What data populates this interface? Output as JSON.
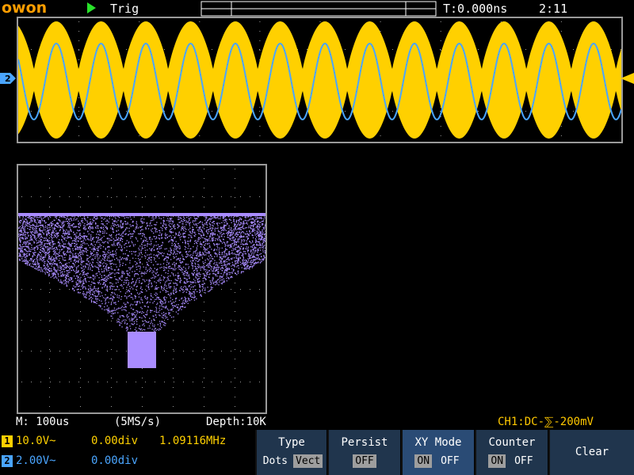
{
  "header": {
    "brand": "owon",
    "trigger_label": "Trig",
    "trigger_time": "T:0.000ns",
    "clock": "2:11"
  },
  "markers": {
    "ch2_marker": "2"
  },
  "status": {
    "timebase": "M: 100us",
    "sample_rate": "(5MS/s)",
    "depth": "Depth:10K",
    "trigger_info": "CH1:DC-⅀-200mV"
  },
  "channels": [
    {
      "id": "1",
      "scale": "10.0V~",
      "offset": "0.00div",
      "frequency": "1.09116MHz",
      "color": "#ffd000"
    },
    {
      "id": "2",
      "scale": "2.00V~",
      "offset": "0.00div",
      "color": "#4aa5ff"
    }
  ],
  "menu": {
    "type": {
      "title": "Type",
      "options": [
        "Dots",
        "Vect"
      ],
      "selected": "Vect"
    },
    "persist": {
      "title": "Persist",
      "value": "OFF"
    },
    "xy_mode": {
      "title": "XY Mode",
      "options": [
        "ON",
        "OFF"
      ],
      "selected": "ON"
    },
    "counter": {
      "title": "Counter",
      "options": [
        "ON",
        "OFF"
      ],
      "selected": "ON"
    },
    "clear": {
      "title": "Clear"
    }
  },
  "colors": {
    "ch1": "#ffd000",
    "ch2": "#4aa5ff",
    "xy_trace": "#a98cff",
    "grid": "#9a9a9a",
    "menu_bg": "#20354d",
    "menu_active_bg": "#2a4b75",
    "brand": "#ff9e00",
    "run_indicator": "#29e22a"
  }
}
